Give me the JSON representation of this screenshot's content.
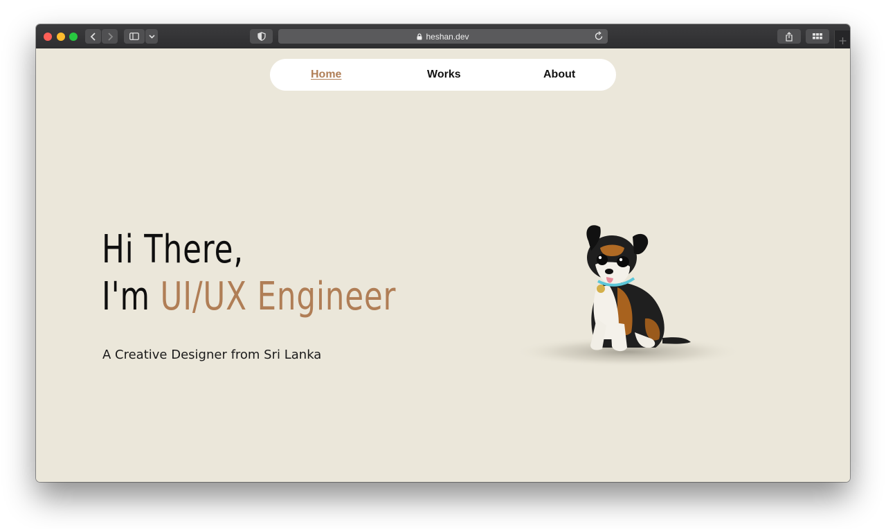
{
  "browser": {
    "url": "heshan.dev",
    "icons": [
      "close-icon",
      "minimize-icon",
      "zoom-icon",
      "back-icon",
      "forward-icon",
      "sidebar-icon",
      "chevron-down-icon",
      "privacy-shield-icon",
      "lock-icon",
      "reload-icon",
      "share-icon",
      "tab-overview-icon",
      "new-tab-icon"
    ]
  },
  "nav": {
    "items": [
      {
        "label": "Home",
        "active": true
      },
      {
        "label": "Works",
        "active": false
      },
      {
        "label": "About",
        "active": false
      }
    ]
  },
  "hero": {
    "line1": "Hi There,",
    "line2_prefix": "I'm",
    "line2_accent": "UI/UX Engineer",
    "subtitle": "A Creative Designer from Sri Lanka"
  },
  "colors": {
    "background": "#ebe7da",
    "accent": "#b07e56",
    "text": "#0e0e0e"
  }
}
